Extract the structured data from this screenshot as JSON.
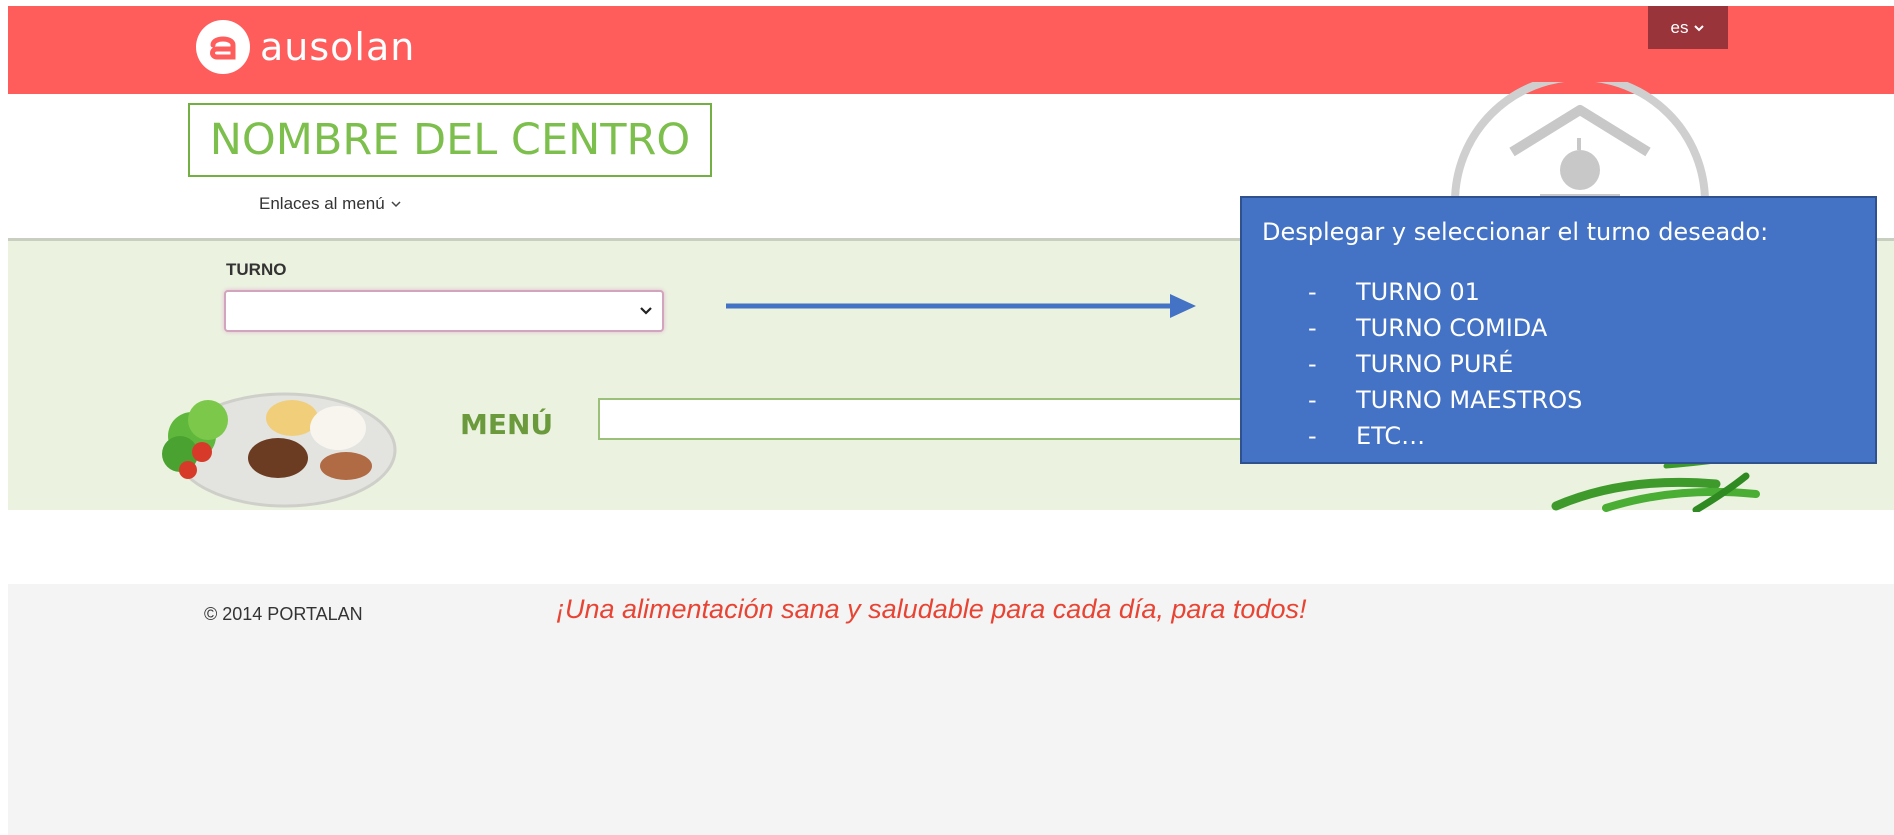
{
  "header": {
    "brand": "ausolan",
    "language": "es",
    "colors": {
      "header_bg": "#ff5c5c",
      "lang_bg": "#98343a"
    }
  },
  "title": "NOMBRE DEL CENTRO",
  "links_label": "Enlaces al menú",
  "form": {
    "turno_label": "TURNO",
    "turno_value": "",
    "menu_label": "MENÚ",
    "menu_value": ""
  },
  "callout": {
    "title": "Desplegar y seleccionar el turno deseado:",
    "items": [
      "TURNO 01",
      "TURNO COMIDA",
      "TURNO PURÉ",
      "TURNO MAESTROS",
      "ETC…"
    ],
    "bullet": "-"
  },
  "footer": {
    "copyright": "© 2014 PORTALAN",
    "slogan": "¡Una alimentación sana y saludable para cada día, para todos!"
  },
  "icons": [
    "ausolan-logo-icon",
    "chevron-down-icon",
    "house-apple-icon",
    "arrow-right-icon",
    "food-plate-image",
    "peas-image"
  ]
}
